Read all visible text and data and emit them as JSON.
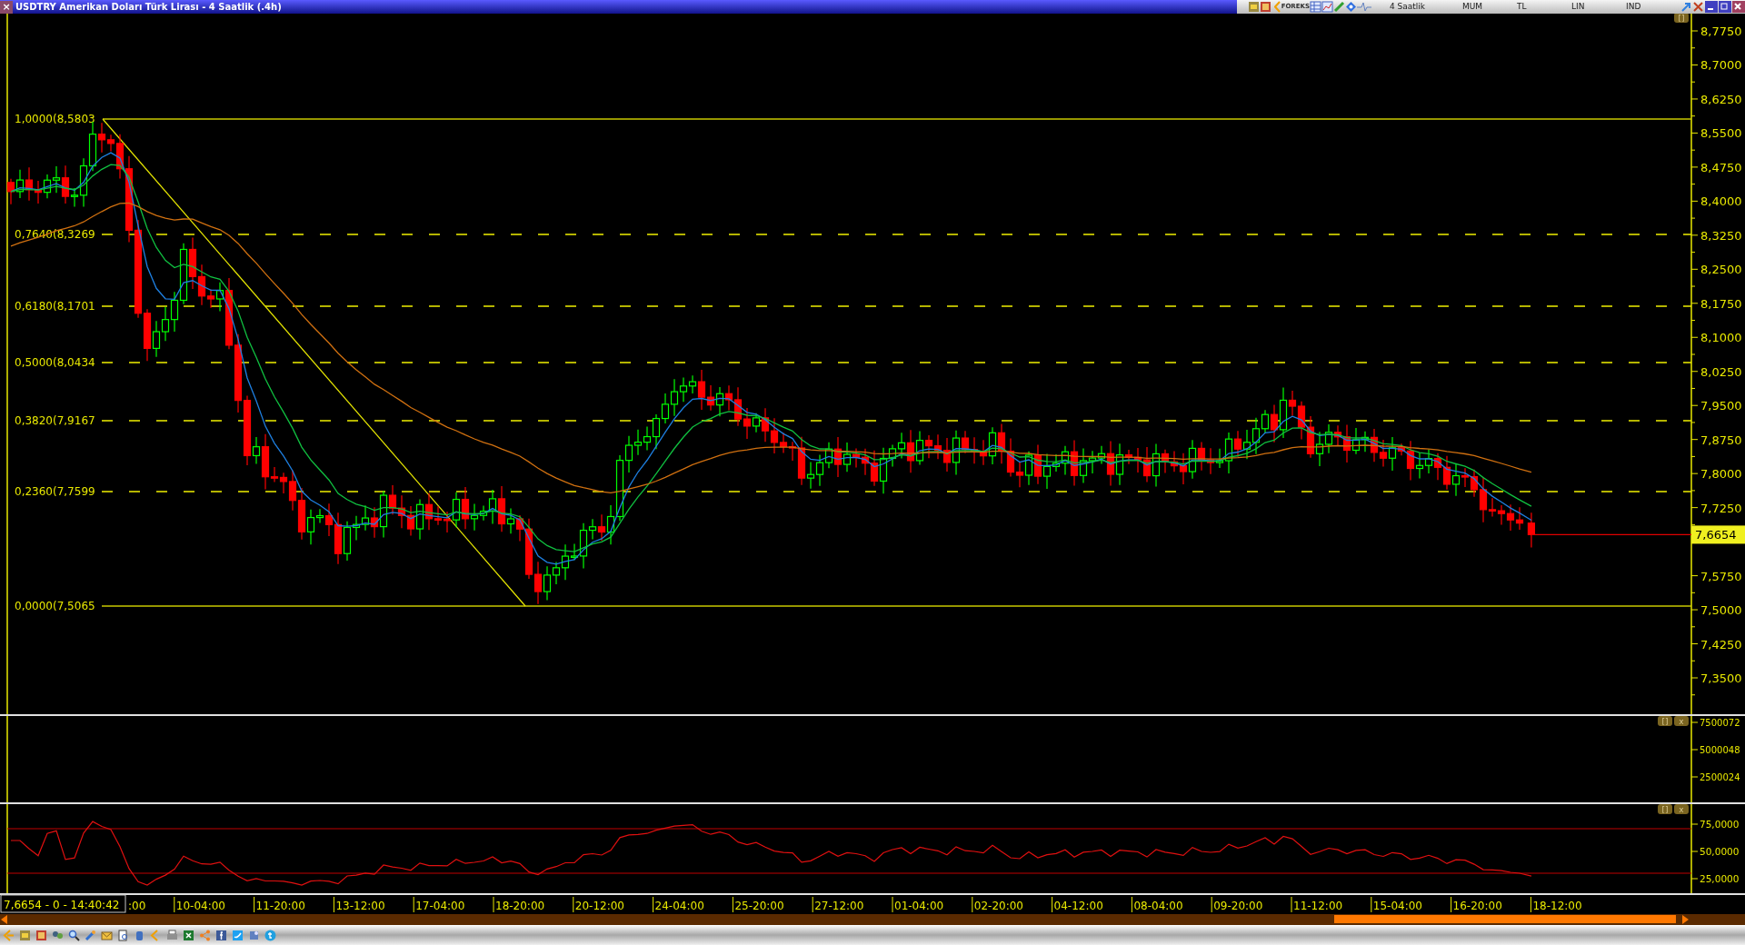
{
  "window": {
    "title": "USDTRY Amerikan Doları Türk Lirası - 4 Saatlik (.4h)",
    "close_button": "×"
  },
  "toolbar": {
    "logo": "FOREKS",
    "items": [
      "4 Saatlik",
      "MUM",
      "TL",
      "LIN",
      "IND"
    ]
  },
  "price_axis": {
    "ticks": [
      "8,7750",
      "8,7000",
      "8,6250",
      "8,5500",
      "8,4750",
      "8,4000",
      "8,3250",
      "8,2500",
      "8,1750",
      "8,1000",
      "8,0250",
      "7,9500",
      "7,8750",
      "7,8000",
      "7,7250",
      "7,5750",
      "7,5000",
      "7,4250",
      "7,3500"
    ],
    "current_price": "7,6654"
  },
  "fibonacci_levels": [
    {
      "label": "1,0000(8,5803",
      "kind": "solid"
    },
    {
      "label": "0,7640(8,3269",
      "kind": "dashed"
    },
    {
      "label": "0,6180(8,1701",
      "kind": "dashed"
    },
    {
      "label": "0,5000(8,0434",
      "kind": "dashed"
    },
    {
      "label": "0,3820(7,9167",
      "kind": "dashed"
    },
    {
      "label": "0,2360(7,7599",
      "kind": "dashed"
    },
    {
      "label": "0,0000(7,5065",
      "kind": "solid"
    }
  ],
  "panel_buttons": {
    "price": [
      "[]"
    ],
    "volume": [
      "[]",
      "x"
    ],
    "rsi": [
      "[]",
      "x"
    ]
  },
  "volume_axis": {
    "ticks": [
      "7500072",
      "5000048",
      "2500024"
    ]
  },
  "rsi_axis": {
    "ticks": [
      "75,0000",
      "50,0000",
      "25,0000"
    ]
  },
  "time_axis": {
    "status": "7,6654 - 0 - 14:40:42",
    "labels": [
      ":00",
      "10-04:00",
      "11-20:00",
      "13-12:00",
      "17-04:00",
      "18-20:00",
      "20-12:00",
      "24-04:00",
      "25-20:00",
      "27-12:00",
      "01-04:00",
      "02-20:00",
      "04-12:00",
      "08-04:00",
      "09-20:00",
      "11-12:00",
      "15-04:00",
      "16-20:00",
      "18-12:00"
    ]
  }
}
